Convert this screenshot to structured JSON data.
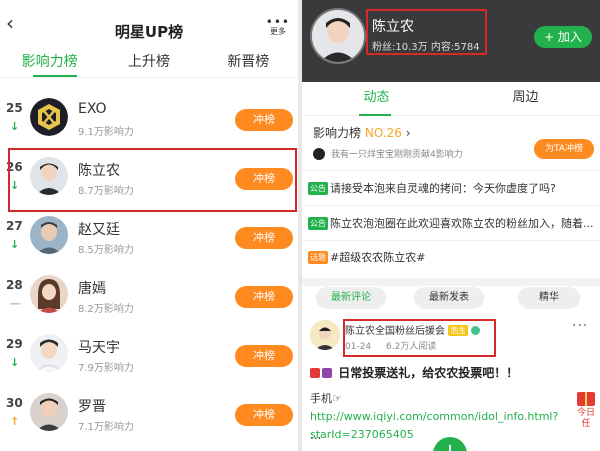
{
  "left": {
    "title": "明星UP榜",
    "more_label": "更多",
    "back_glyph": "‹",
    "tabs": [
      {
        "label": "影响力榜",
        "active": true
      },
      {
        "label": "上升榜",
        "active": false
      },
      {
        "label": "新晋榜",
        "active": false
      }
    ],
    "rows": [
      {
        "rank": "25",
        "name": "EXO",
        "influence": "9.1万影响力",
        "trend": "down",
        "trend_glyph": "↓",
        "button": "冲榜",
        "avatar_icon": "exo-logo-icon"
      },
      {
        "rank": "26",
        "name": "陈立农",
        "influence": "8.7万影响力",
        "trend": "down",
        "trend_glyph": "↓",
        "button": "冲榜",
        "avatar_icon": "portrait-icon"
      },
      {
        "rank": "27",
        "name": "赵又廷",
        "influence": "8.5万影响力",
        "trend": "down",
        "trend_glyph": "↓",
        "button": "冲榜",
        "avatar_icon": "portrait-icon"
      },
      {
        "rank": "28",
        "name": "唐嫣",
        "influence": "8.2万影响力",
        "trend": "flat",
        "trend_glyph": "—",
        "button": "冲榜",
        "avatar_icon": "portrait-icon"
      },
      {
        "rank": "29",
        "name": "马天宇",
        "influence": "7.9万影响力",
        "trend": "down",
        "trend_glyph": "↓",
        "button": "冲榜",
        "avatar_icon": "portrait-icon"
      },
      {
        "rank": "30",
        "name": "罗晋",
        "influence": "7.1万影响力",
        "trend": "up",
        "trend_glyph": "↑",
        "button": "冲榜",
        "avatar_icon": "portrait-icon"
      }
    ]
  },
  "right": {
    "header": {
      "name": "陈立农",
      "stats": "粉丝:10.3万  内容:5784",
      "join_label": "+ 加入"
    },
    "tabs": [
      {
        "label": "动态",
        "active": true
      },
      {
        "label": "周边",
        "active": false
      }
    ],
    "influence_label": "影响力榜",
    "influence_rank": "NO.26",
    "influence_arrow": "›",
    "contributor_text": "我有一只烊宝宝刚刚贡献4影响力",
    "ta_button": "为TA冲榜",
    "notices": [
      {
        "badge": "公告",
        "badge_color": "green",
        "text": "请接受本泡来自灵魂的拷问：今天你虚度了吗?"
      },
      {
        "badge": "公告",
        "badge_color": "green",
        "text": "陈立农泡泡圈在此欢迎喜欢陈立农的粉丝加入，随着..."
      },
      {
        "badge": "话题",
        "badge_color": "orange",
        "text": "#超级农农陈立农#"
      }
    ],
    "filter_pills": [
      {
        "label": "最新评论",
        "active": true
      },
      {
        "label": "最新发表",
        "active": false
      },
      {
        "label": "精华",
        "active": false
      }
    ],
    "post": {
      "author": "陈立农全国粉丝后援会",
      "owner_badge": "泡主",
      "date": "01-24",
      "reads": "6.2万人阅读",
      "more": "···",
      "title": "日常投票送礼，给农农投票吧！！",
      "body_prefix": "手机☞",
      "link": "http://www.iqiyi.com/common/idol_info.html?starId=237065405",
      "ellipsis": "...",
      "fab": "+"
    },
    "gift_label": "今日任"
  },
  "colors": {
    "brand_green": "#22b14c",
    "action_orange": "#ff8a1f",
    "highlight_red": "#d42a2a",
    "header_dark": "#3a3a3c"
  }
}
